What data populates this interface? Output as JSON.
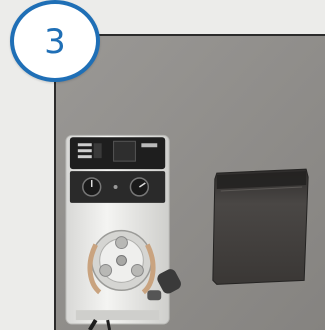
{
  "step": {
    "number": "3"
  },
  "photo": {
    "subject": "peristaltic-pump-with-cover-removed",
    "colors": {
      "background": "#8f8d8a",
      "pump_body": "#ececec",
      "control_panel": "#222222",
      "cover": "#3f3c3a",
      "accent": "#1f6fb6"
    }
  }
}
